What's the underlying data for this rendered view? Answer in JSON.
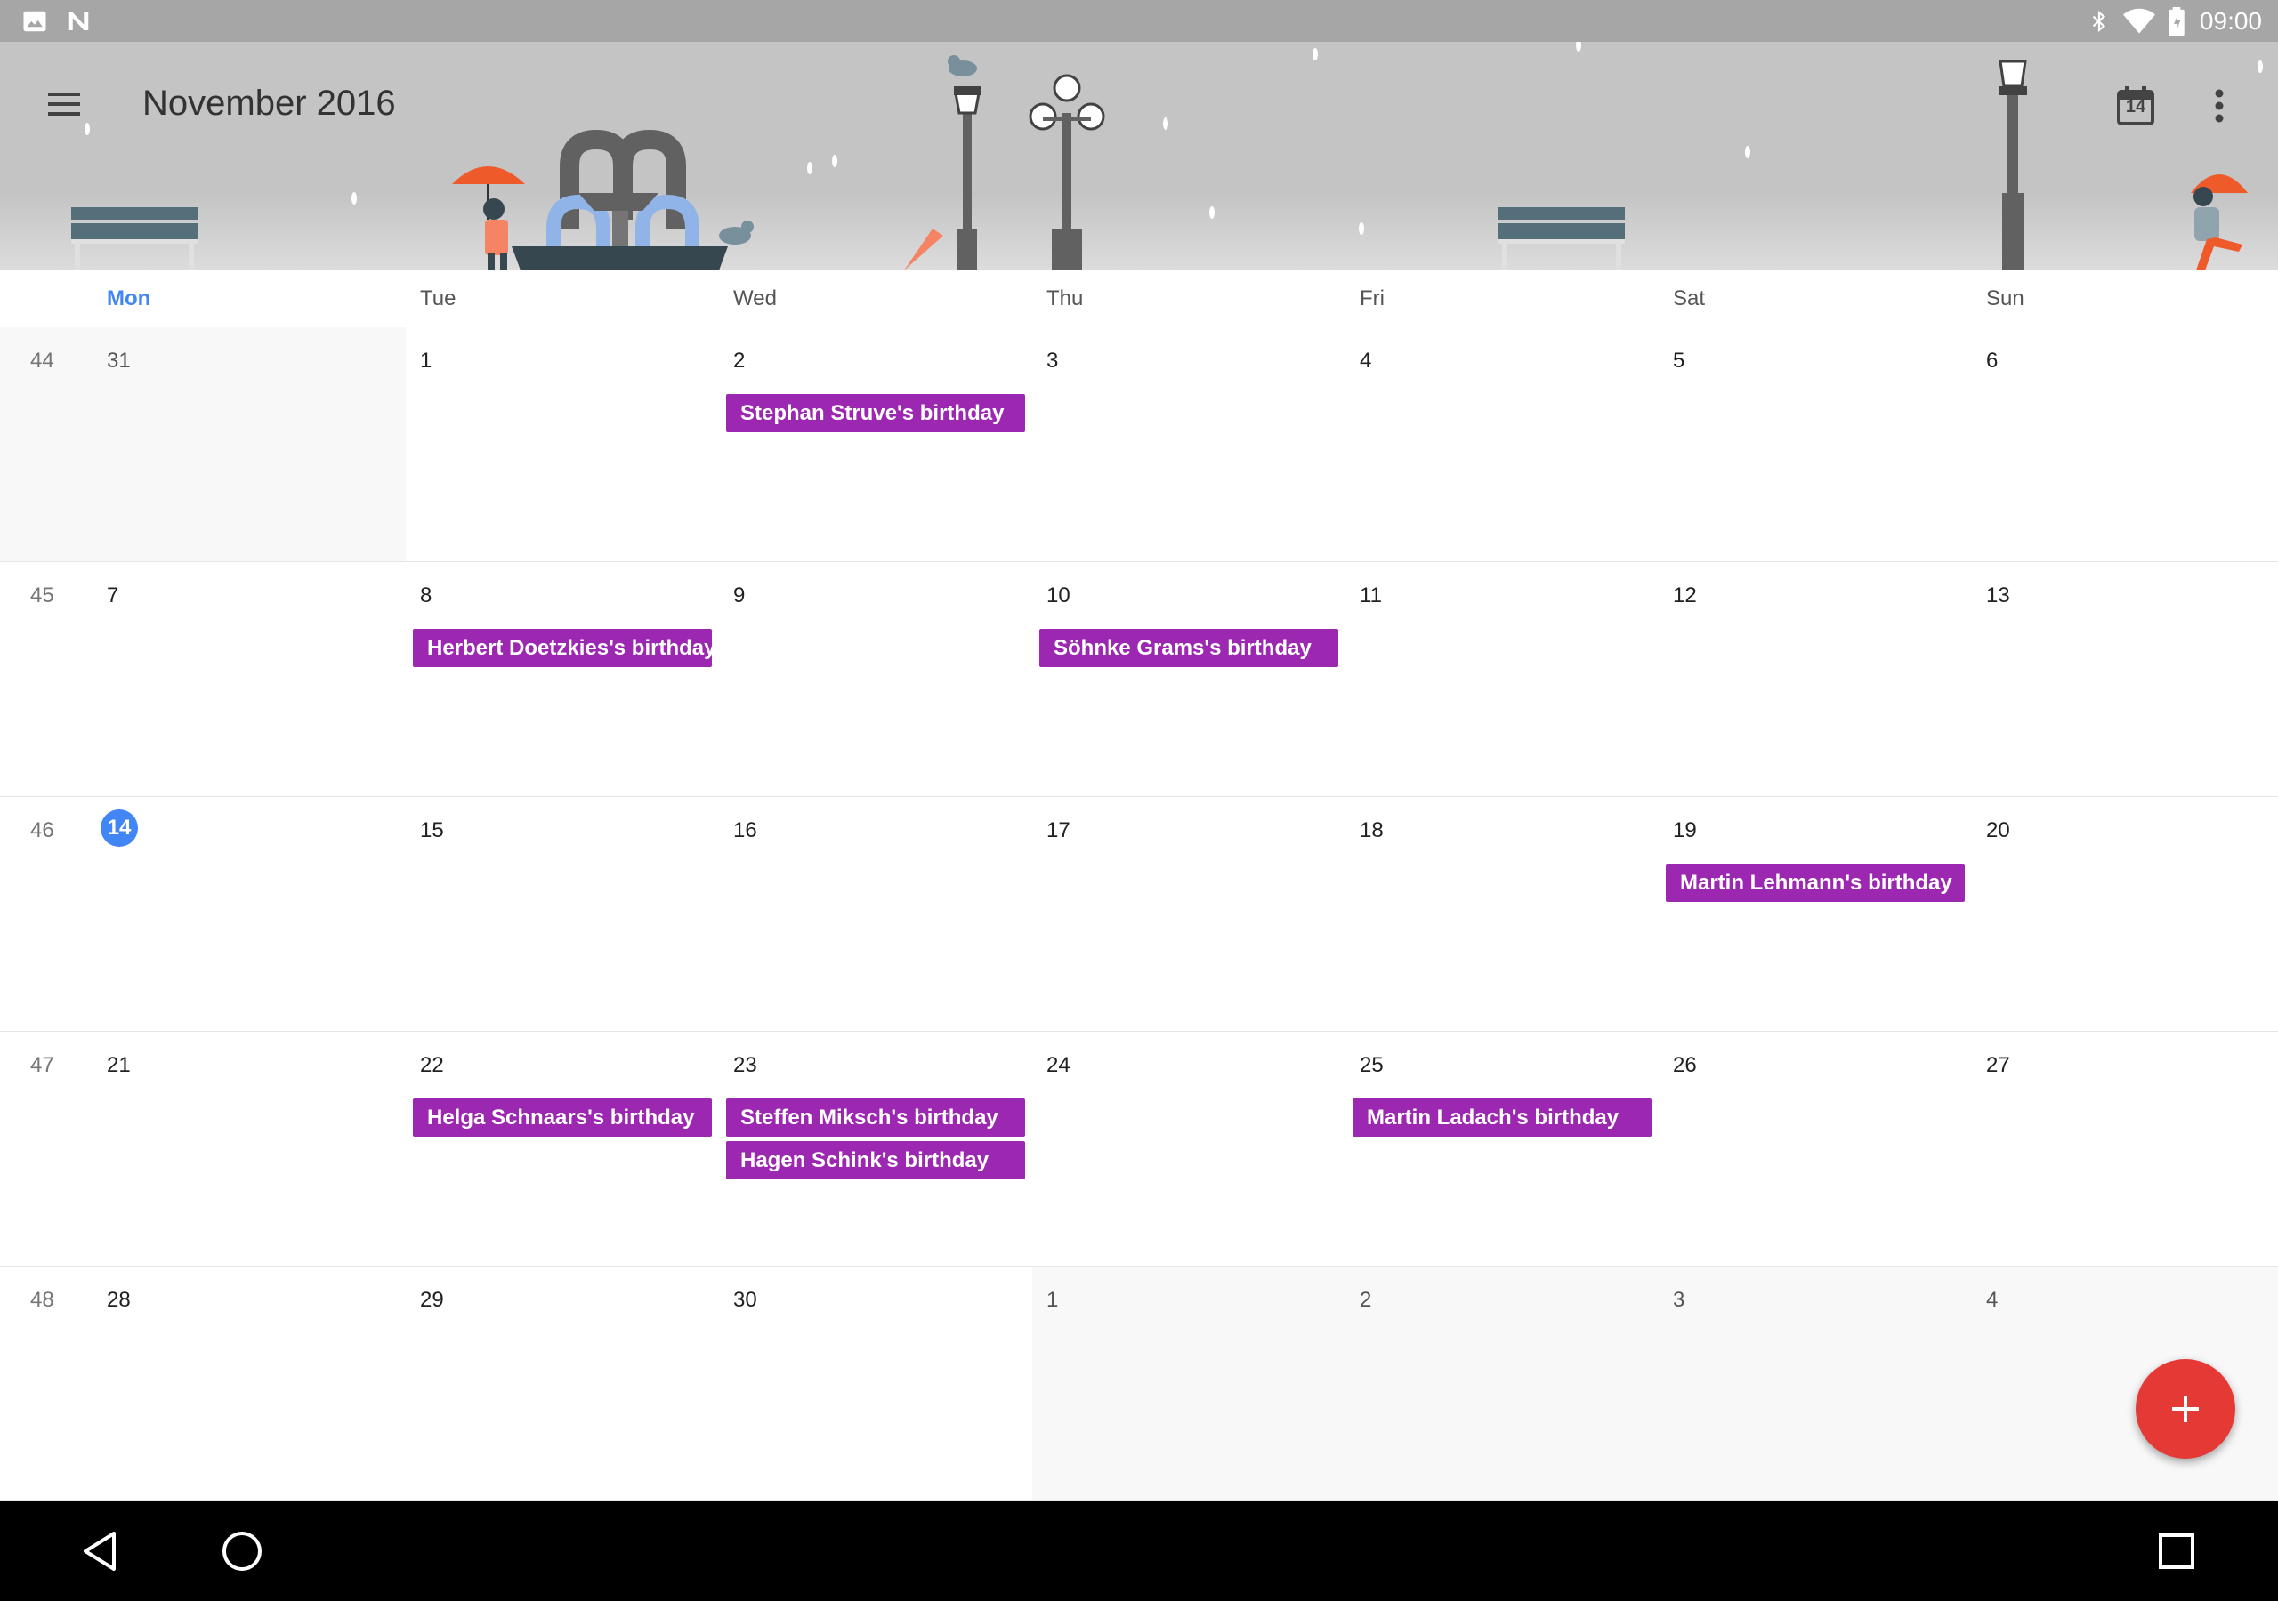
{
  "status_bar": {
    "time": "09:00",
    "left_icons": [
      "gallery-icon",
      "n-logo-icon"
    ],
    "right_icons": [
      "bluetooth-icon",
      "wifi-icon",
      "battery-icon"
    ]
  },
  "header": {
    "title": "November 2016",
    "today_day": "14",
    "menu_icon": "hamburger-icon",
    "overflow_icon": "more-vert-icon",
    "background_color": "#c4c4c4"
  },
  "weekdays": [
    "Mon",
    "Tue",
    "Wed",
    "Thu",
    "Fri",
    "Sat",
    "Sun"
  ],
  "today_weekday_index": 0,
  "weeks": [
    {
      "number": "44",
      "days": [
        {
          "label": "31",
          "outside": true
        },
        {
          "label": "1",
          "outside": false
        },
        {
          "label": "2",
          "outside": false,
          "events": [
            "Stephan Struve's birthday"
          ]
        },
        {
          "label": "3",
          "outside": false
        },
        {
          "label": "4",
          "outside": false
        },
        {
          "label": "5",
          "outside": false
        },
        {
          "label": "6",
          "outside": false
        }
      ]
    },
    {
      "number": "45",
      "days": [
        {
          "label": "7",
          "outside": false
        },
        {
          "label": "8",
          "outside": false,
          "events": [
            "Herbert Doetzkies's birthday"
          ]
        },
        {
          "label": "9",
          "outside": false
        },
        {
          "label": "10",
          "outside": false,
          "events": [
            "Söhnke Grams's birthday"
          ]
        },
        {
          "label": "11",
          "outside": false
        },
        {
          "label": "12",
          "outside": false
        },
        {
          "label": "13",
          "outside": false
        }
      ]
    },
    {
      "number": "46",
      "days": [
        {
          "label": "14",
          "outside": false,
          "today": true
        },
        {
          "label": "15",
          "outside": false
        },
        {
          "label": "16",
          "outside": false
        },
        {
          "label": "17",
          "outside": false
        },
        {
          "label": "18",
          "outside": false
        },
        {
          "label": "19",
          "outside": false,
          "events": [
            "Martin Lehmann's birthday"
          ]
        },
        {
          "label": "20",
          "outside": false
        }
      ]
    },
    {
      "number": "47",
      "days": [
        {
          "label": "21",
          "outside": false
        },
        {
          "label": "22",
          "outside": false,
          "events": [
            "Helga Schnaars's birthday"
          ]
        },
        {
          "label": "23",
          "outside": false,
          "events": [
            "Steffen Miksch's birthday",
            "Hagen Schink's birthday"
          ]
        },
        {
          "label": "24",
          "outside": false
        },
        {
          "label": "25",
          "outside": false,
          "events": [
            "Martin Ladach's birthday"
          ]
        },
        {
          "label": "26",
          "outside": false
        },
        {
          "label": "27",
          "outside": false
        }
      ]
    },
    {
      "number": "48",
      "days": [
        {
          "label": "28",
          "outside": false
        },
        {
          "label": "29",
          "outside": false
        },
        {
          "label": "30",
          "outside": false
        },
        {
          "label": "1",
          "outside": true
        },
        {
          "label": "2",
          "outside": true
        },
        {
          "label": "3",
          "outside": true
        },
        {
          "label": "4",
          "outside": true
        }
      ]
    }
  ],
  "colors": {
    "event": "#9c27b0",
    "today": "#4285f4",
    "fab": "#e53935",
    "status_bar": "#a6a6a6",
    "nav_bar": "#000000"
  },
  "fab": {
    "icon": "plus-icon"
  },
  "nav_bar": {
    "icons": [
      "back-icon",
      "home-icon",
      "recents-icon"
    ]
  }
}
